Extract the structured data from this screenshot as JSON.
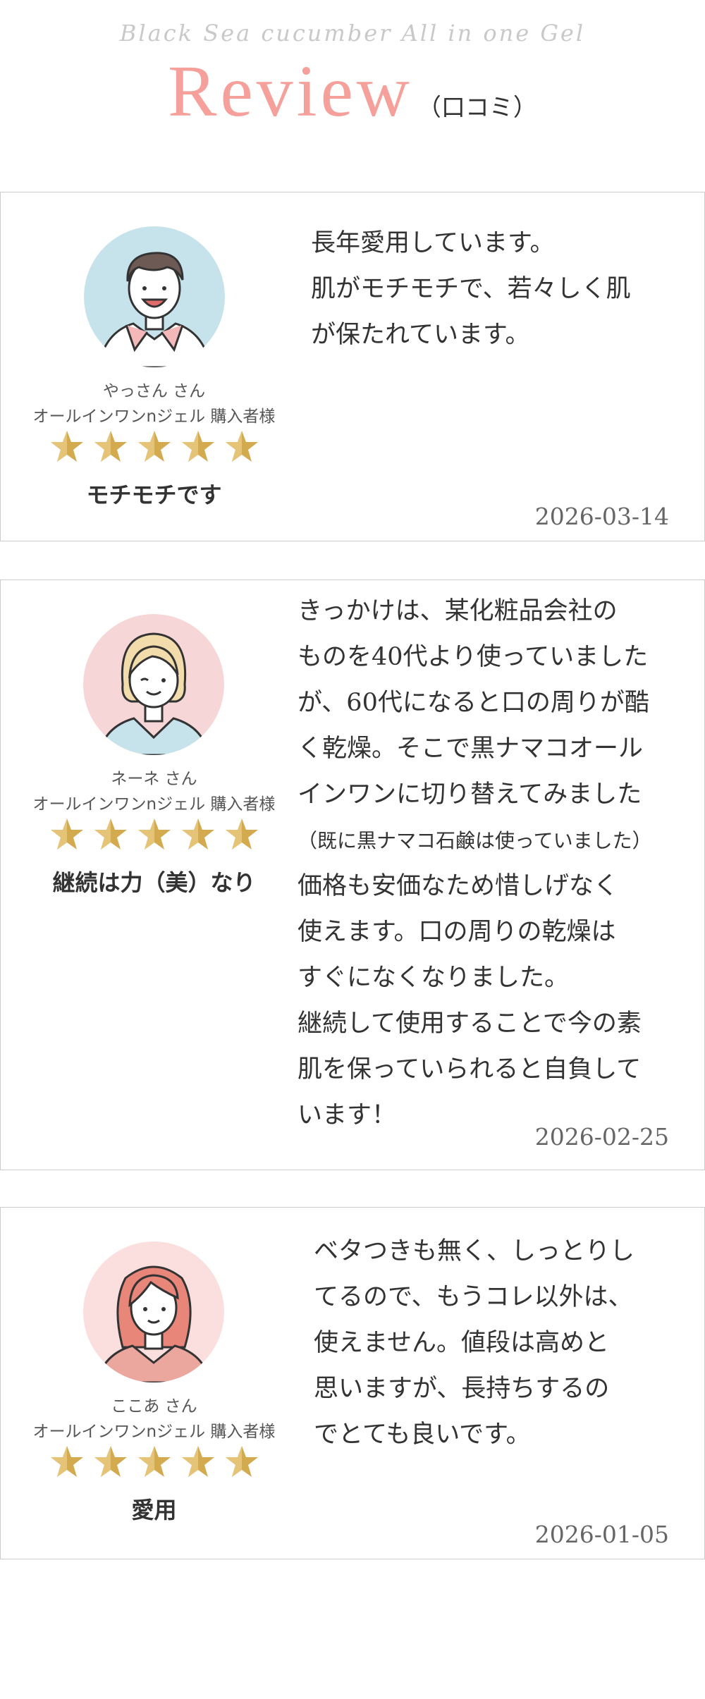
{
  "header": {
    "script_title": "Black Sea cucumber All in one Gel",
    "title": "Review",
    "subtitle": "（口コミ）"
  },
  "reviews": [
    {
      "name": "やっさん さん",
      "purchaser": "オールインワンnジェル  購入者様",
      "rating": 5,
      "headline": "モチモチです",
      "body": [
        "長年愛用しています。",
        "肌がモチモチで、若々しく肌",
        "が保たれています。"
      ],
      "date": "2026-03-14"
    },
    {
      "name": "ネーネ さん",
      "purchaser": "オールインワンnジェル  購入者様",
      "rating": 5,
      "headline": "継続は力（美）なり",
      "body": [
        "きっかけは、某化粧品会社の",
        "ものを40代より使っていました",
        "が、60代になると口の周りが酷",
        "く乾燥。そこで黒ナマコオール",
        "インワンに切り替えてみました",
        "（既に黒ナマコ石鹸は使っていました）",
        "価格も安価なため惜しげなく",
        "使えます。口の周りの乾燥は",
        "すぐになくなりました。",
        "継続して使用することで今の素",
        "肌を保っていられると自負して",
        "います！"
      ],
      "date": "2026-02-25"
    },
    {
      "name": "ここあ さん",
      "purchaser": "オールインワンnジェル  購入者様",
      "rating": 5,
      "headline": "愛用",
      "body": [
        "ベタつきも無く、しっとりし",
        "てるので、もうコレ以外は、",
        "使えません。値段は高めと",
        "思いますが、長持ちするの",
        "でとても良いです。"
      ],
      "date": "2026-01-05"
    }
  ],
  "colors": {
    "title_pink": "#f5a09a",
    "star_gold": "#d4aa4f",
    "card_border": "#cccccc",
    "avatar_bg_1": "#c6e3ec",
    "avatar_bg_2": "#f6d6d6",
    "avatar_bg_3": "#fbdede"
  },
  "icons": [
    "male-avatar-icon",
    "female-short-hair-avatar-icon",
    "female-long-hair-avatar-icon",
    "star-icon"
  ]
}
